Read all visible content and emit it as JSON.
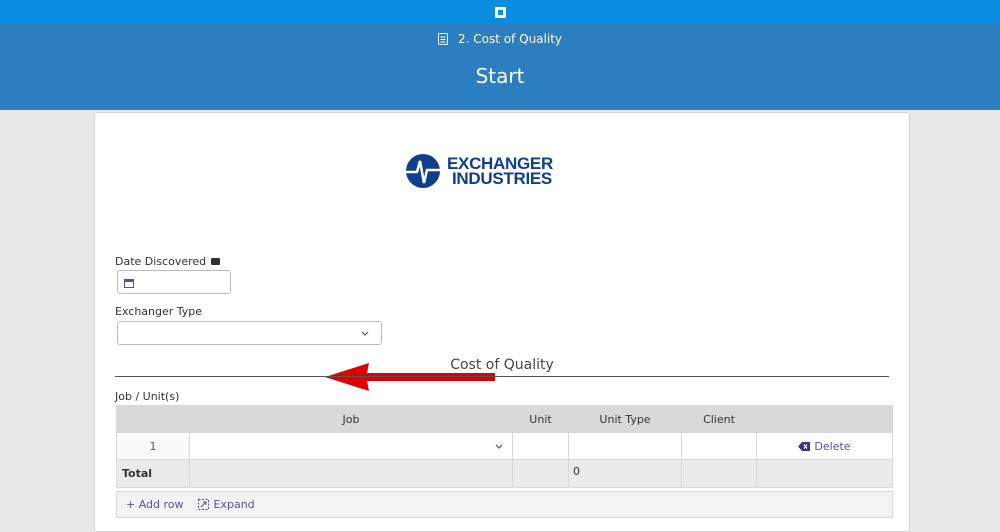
{
  "header": {
    "breadcrumb": "2. Cost of Quality",
    "title": "Start"
  },
  "logo": {
    "line1": "EXCHANGER",
    "line2": "INDUSTRIES"
  },
  "form": {
    "date_label": "Date Discovered",
    "date_value": "",
    "type_label": "Exchanger Type",
    "type_value": "",
    "section_title": "Cost of Quality",
    "table_label": "Job / Unit(s)"
  },
  "table": {
    "columns": [
      "",
      "Job",
      "Unit",
      "Unit Type",
      "Client",
      ""
    ],
    "rows": [
      {
        "num": "1",
        "job": "",
        "unit": "",
        "unit_type": "",
        "client": "",
        "delete": "Delete"
      }
    ],
    "total": {
      "label": "Total",
      "unit_type": "0"
    },
    "add_row": "Add row",
    "expand": "Expand"
  },
  "colors": {
    "topbar": "#0a8de0",
    "band": "#2b7fc0",
    "accent": "#5a4fa0",
    "arrow": "#e00000"
  }
}
